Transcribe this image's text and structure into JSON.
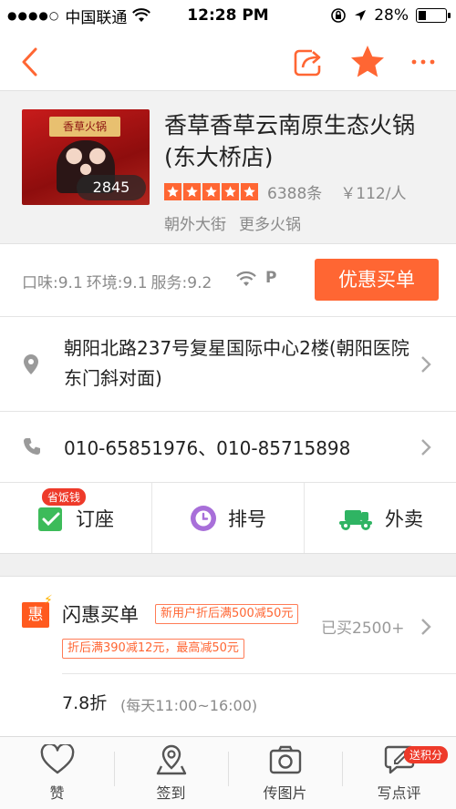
{
  "status_bar": {
    "carrier": "中国联通",
    "time": "12:28 PM",
    "battery": "28%",
    "battery_level": 0.28
  },
  "shop": {
    "name": "香草香草云南原生态火锅(东大桥店)",
    "photo_sign": "香草火锅",
    "photo_count": "2845",
    "star_rating": 5,
    "review_count": "6388条",
    "price_per_person": "￥112/人",
    "tags": [
      "朝外大街",
      "更多火锅"
    ]
  },
  "scores": {
    "taste": "口味:9.1",
    "environment": "环境:9.1",
    "service": "服务:9.2",
    "parking_label": "P"
  },
  "pay_button": "优惠买单",
  "address": "朝阳北路237号复星国际中心2楼(朝阳医院东门斜对面)",
  "phone": "010-65851976、010-85715898",
  "actions": [
    {
      "label": "订座",
      "badge": "省饭钱",
      "color": "#3dbb5a"
    },
    {
      "label": "排号",
      "color": "#a86fd9"
    },
    {
      "label": "外卖",
      "color": "#2fb463"
    }
  ],
  "flash_deal": {
    "icon_text": "惠",
    "title": "闪惠买单",
    "tag1": "新用户折后满500减50元",
    "tag2": "折后满390减12元，最高减50元",
    "sold": "已买2500+",
    "discount_rate": "7.8折",
    "hours": "(每天11:00~16:00)"
  },
  "tab_bar": [
    {
      "label": "赞",
      "icon": "heart-icon"
    },
    {
      "label": "签到",
      "icon": "location-pin-icon"
    },
    {
      "label": "传图片",
      "icon": "camera-icon"
    },
    {
      "label": "写点评",
      "icon": "comment-edit-icon",
      "badge": "送积分"
    }
  ],
  "colors": {
    "accent": "#ff6633",
    "badge_red": "#ee3a2a"
  }
}
